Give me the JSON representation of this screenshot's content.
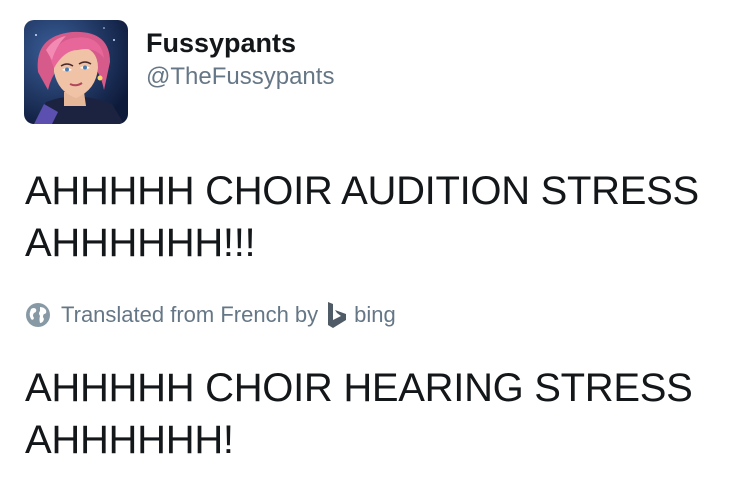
{
  "tweet": {
    "display_name": "Fussypants",
    "handle": "@TheFussypants",
    "original_text": "AHHHHH CHOIR AUDITION STRESS AHHHHHH!!!",
    "translation_label": "Translated from French by",
    "translation_provider": "bing",
    "translated_text": "AHHHHH CHOIR HEARING STRESS AHHHHHH!"
  },
  "icons": {
    "avatar": "avatar-illustration",
    "globe": "globe-icon",
    "bing": "bing-logo-icon"
  },
  "colors": {
    "text": "#14171a",
    "secondary": "#657786",
    "background": "#ffffff"
  }
}
